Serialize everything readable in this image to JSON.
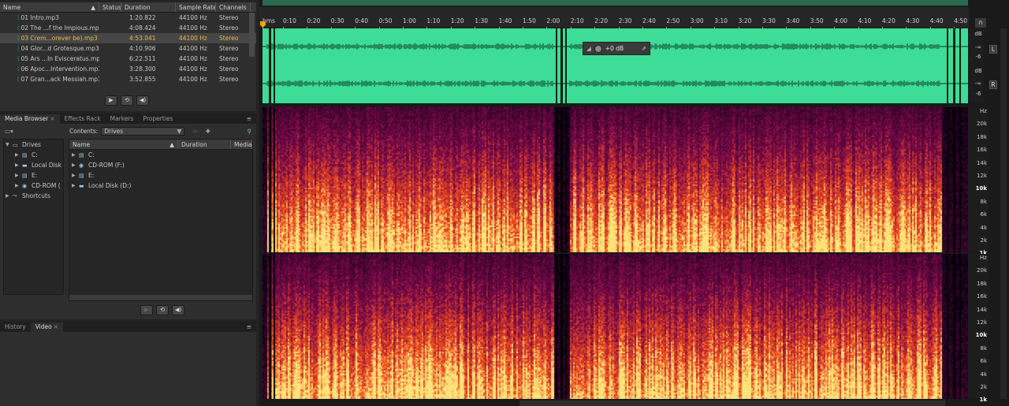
{
  "files_panel": {
    "columns": [
      "Name",
      "Status",
      "Duration",
      "Sample Rate",
      "Channels"
    ],
    "files": [
      {
        "name": "01 Intro.mp3",
        "duration": "1:20.822",
        "sample_rate": "44100 Hz",
        "channels": "Stereo",
        "selected": false
      },
      {
        "name": "02 The ...f the Impious.mp3",
        "duration": "4:08.424",
        "sample_rate": "44100 Hz",
        "channels": "Stereo",
        "selected": false
      },
      {
        "name": "03 Crem...orever be).mp3",
        "duration": "4:53.041",
        "sample_rate": "44100 Hz",
        "channels": "Stereo",
        "selected": true
      },
      {
        "name": "04 Glor...d Grotesque.mp3",
        "duration": "4:10.906",
        "sample_rate": "44100 Hz",
        "channels": "Stereo",
        "selected": false
      },
      {
        "name": "05 Ars ...In Evisceratus.mp3",
        "duration": "6:22.511",
        "sample_rate": "44100 Hz",
        "channels": "Stereo",
        "selected": false
      },
      {
        "name": "06 Apoc...Intervention.mp3",
        "duration": "3:28.300",
        "sample_rate": "44100 Hz",
        "channels": "Stereo",
        "selected": false
      },
      {
        "name": "07 Gran...ack Messiah.mp3",
        "duration": "3:52.855",
        "sample_rate": "44100 Hz",
        "channels": "Stereo",
        "selected": false
      }
    ],
    "controls": [
      "play-icon",
      "loop-icon",
      "speaker-icon"
    ]
  },
  "browser_panel": {
    "tabs": [
      "Media Browser",
      "Effects Rack",
      "Markers",
      "Properties"
    ],
    "contents_label": "Contents:",
    "contents_value": "Drives",
    "tree": [
      {
        "label": "Drives",
        "icon": "drives-icon"
      },
      {
        "label": "C:",
        "icon": "drive-icon"
      },
      {
        "label": "Local Disk",
        "icon": "disk-icon"
      },
      {
        "label": "E:",
        "icon": "drive-icon"
      },
      {
        "label": "CD-ROM (",
        "icon": "cdrom-icon"
      },
      {
        "label": "Shortcuts",
        "icon": "shortcuts-icon"
      }
    ],
    "list_columns": [
      "Name",
      "Duration",
      "Media"
    ],
    "list_items": [
      {
        "label": "C:",
        "icon": "drive-icon"
      },
      {
        "label": "CD-ROM (F:)",
        "icon": "cdrom-icon"
      },
      {
        "label": "E:",
        "icon": "drive-icon"
      },
      {
        "label": "Local Disk (D:)",
        "icon": "disk-icon"
      }
    ]
  },
  "bottom_panel": {
    "tabs": [
      "History",
      "Video"
    ]
  },
  "editor": {
    "ruler_label": "hms",
    "ruler_ticks": [
      "0:10",
      "0:20",
      "0:30",
      "0:40",
      "0:50",
      "1:00",
      "1:10",
      "1:20",
      "1:30",
      "1:40",
      "1:50",
      "2:00",
      "2:10",
      "2:20",
      "2:30",
      "2:40",
      "2:50",
      "3:00",
      "3:10",
      "3:20",
      "3:30",
      "3:40",
      "3:50",
      "4:00",
      "4:10",
      "4:20",
      "4:30",
      "4:40",
      "4:50"
    ],
    "hud_gain": "+0 dB",
    "db_scale": [
      "dB",
      "-∞",
      "-6",
      "dB",
      "-∞",
      "-6"
    ],
    "channel_buttons": [
      "L",
      "R"
    ],
    "hz_scale": [
      {
        "t": "Hz",
        "bold": false
      },
      {
        "t": "20k",
        "bold": false
      },
      {
        "t": "18k",
        "bold": false
      },
      {
        "t": "16k",
        "bold": false
      },
      {
        "t": "14k",
        "bold": false
      },
      {
        "t": "12k",
        "bold": false
      },
      {
        "t": "10k",
        "bold": true
      },
      {
        "t": "8k",
        "bold": false
      },
      {
        "t": "6k",
        "bold": false
      },
      {
        "t": "4k",
        "bold": false
      },
      {
        "t": "2k",
        "bold": false
      },
      {
        "t": "1k",
        "bold": true
      }
    ],
    "colors": {
      "waveform_bg": "#3ddc97",
      "waveform_line": "#0b3a24",
      "spec_low": "#ffe47a",
      "spec_mid": "#f04a1c",
      "spec_high": "#7a0a4a"
    }
  }
}
